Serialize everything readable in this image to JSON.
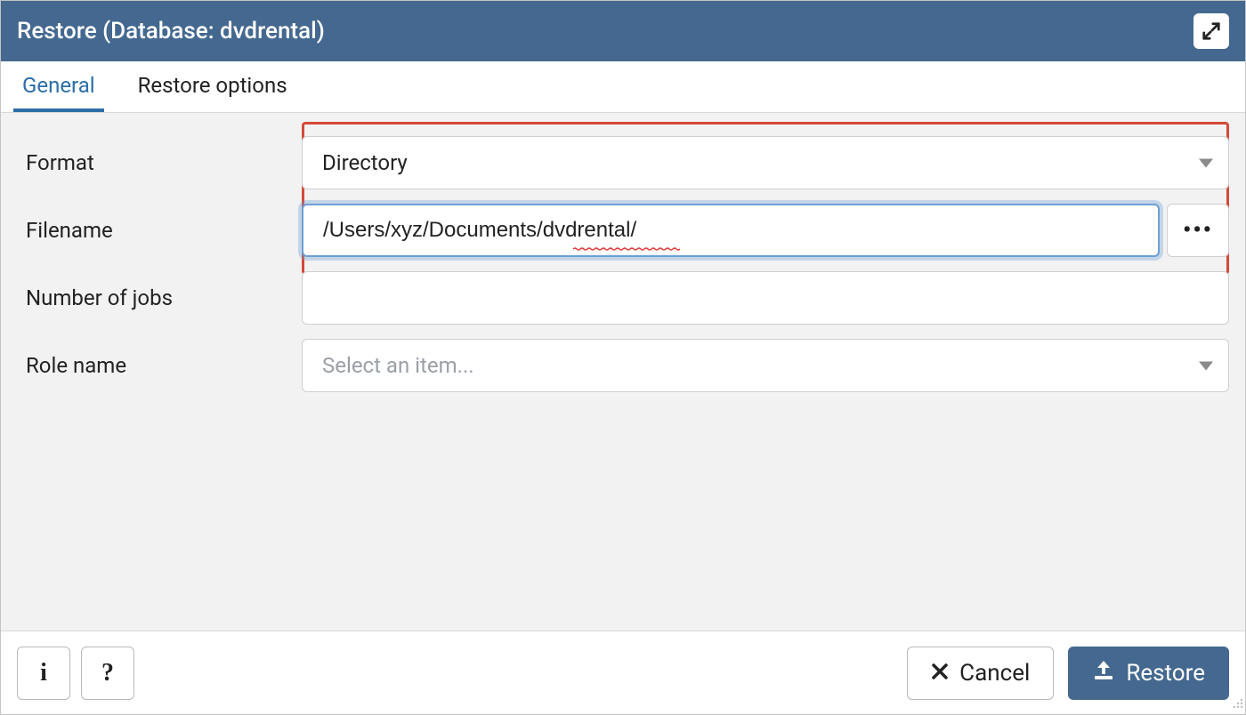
{
  "dialog": {
    "title": "Restore (Database: dvdrental)"
  },
  "tabs": {
    "general": "General",
    "restore_options": "Restore options"
  },
  "form": {
    "format": {
      "label": "Format",
      "value": "Directory"
    },
    "filename": {
      "label": "Filename",
      "value": "/Users/xyz/Documents/dvdrental/"
    },
    "jobs": {
      "label": "Number of jobs",
      "value": ""
    },
    "role": {
      "label": "Role name",
      "placeholder": "Select an item..."
    }
  },
  "footer": {
    "info": "i",
    "help": "?",
    "cancel": "Cancel",
    "restore": "Restore"
  },
  "icons": {
    "browse": "•••",
    "close_x": "✖"
  }
}
